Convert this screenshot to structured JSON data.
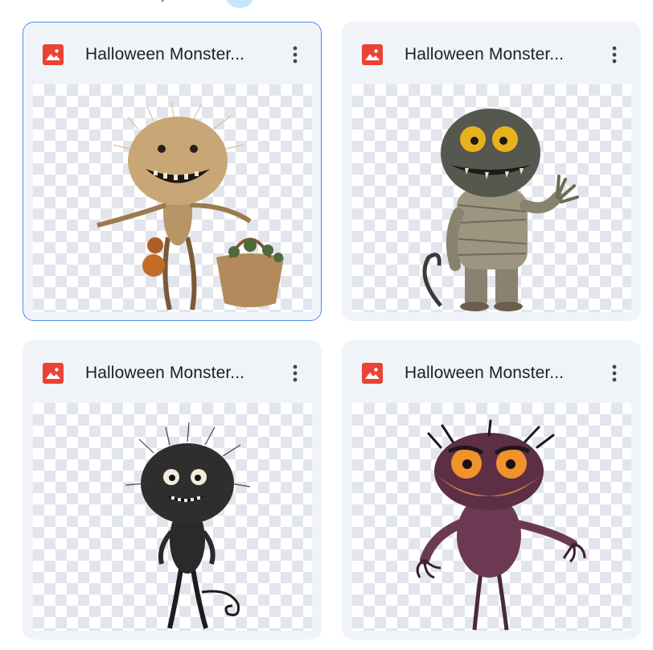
{
  "header": {
    "partial_text": "y"
  },
  "files": [
    {
      "title": "Halloween Monster...",
      "icon": "image-file-icon",
      "selected": true,
      "thumbnail": "tan-furry-monster-with-basket"
    },
    {
      "title": "Halloween Monster...",
      "icon": "image-file-icon",
      "selected": false,
      "thumbnail": "gray-mummy-monster-waving"
    },
    {
      "title": "Halloween Monster...",
      "icon": "image-file-icon",
      "selected": false,
      "thumbnail": "black-fuzzy-monster-with-curly-tail"
    },
    {
      "title": "Halloween Monster...",
      "icon": "image-file-icon",
      "selected": false,
      "thumbnail": "purple-orange-eyed-monster"
    }
  ],
  "colors": {
    "card_bg": "#f0f4f9",
    "selected_border": "#4c8df6",
    "file_icon_red": "#ea4335",
    "title_text": "#1f1f1f"
  }
}
